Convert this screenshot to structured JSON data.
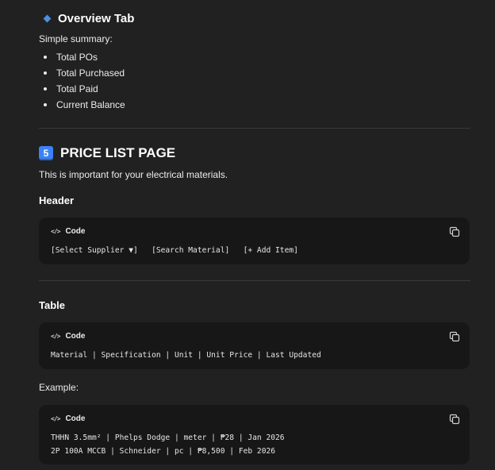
{
  "overview": {
    "title": "Overview Tab",
    "intro": "Simple summary:",
    "items": [
      "Total POs",
      "Total Purchased",
      "Total Paid",
      "Current Balance"
    ]
  },
  "price_list": {
    "number": "5",
    "title": "PRICE LIST PAGE",
    "intro": "This is important for your electrical materials."
  },
  "header_section": {
    "heading": "Header",
    "code_label": "Code",
    "lines": [
      "[Select Supplier ▼]   [Search Material]   [+ Add Item]"
    ]
  },
  "table_section": {
    "heading": "Table",
    "code_label": "Code",
    "lines": [
      "Material | Specification | Unit | Unit Price | Last Updated"
    ]
  },
  "example_section": {
    "label": "Example:",
    "code_label": "Code",
    "lines": [
      "THHN 3.5mm² | Phelps Dodge | meter | ₱28 | Jan 2026",
      "2P 100A MCCB | Schneider | pc | ₱8,500 | Feb 2026"
    ]
  },
  "icons": {
    "heading_marker": "blue-diamond-icon",
    "number_badge": "keycap-five-icon",
    "code": "code-brackets-icon",
    "copy": "copy-icon"
  },
  "colors": {
    "background": "#212121",
    "code_background": "#171717",
    "accent_blue": "#3b82f6"
  }
}
